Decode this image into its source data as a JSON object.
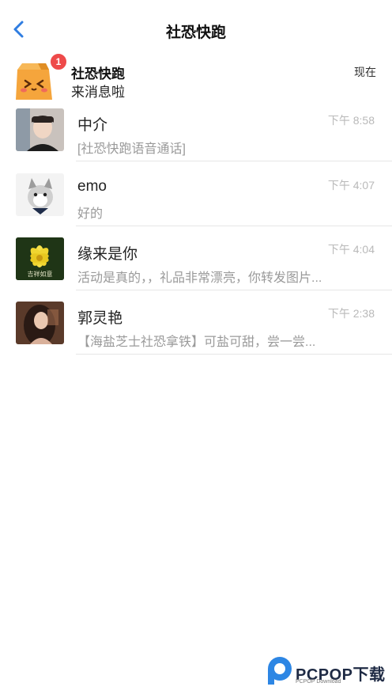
{
  "nav": {
    "back_icon": "chevron-left-icon",
    "title": "社恐快跑"
  },
  "pinned": {
    "name": "社恐快跑",
    "message": "来消息啦",
    "time": "现在",
    "badge": "1",
    "avatar_icon": "paper-bag-mascot-icon"
  },
  "chats": [
    {
      "name": "中介",
      "message": "[社恐快跑语音通话]",
      "time": "下午 8:58"
    },
    {
      "name": "emo",
      "message": "好的",
      "time": "下午 4:07"
    },
    {
      "name": "缘来是你",
      "message": "活动是真的，，礼品非常漂亮，你转发图片...",
      "time": "下午 4:04",
      "avatar_caption": "吉祥如意"
    },
    {
      "name": "郭灵艳",
      "message": "【海盐芝士社恐拿铁】可盐可甜，尝一尝...",
      "time": "下午 2:38"
    }
  ],
  "watermark": {
    "text": "PCPOP下载",
    "sub": "PCPOP Download"
  },
  "colors": {
    "accent": "#2f7de1",
    "badge": "#ee4a4a",
    "mascot": "#f5a53c",
    "divider": "#e6e6e6"
  }
}
